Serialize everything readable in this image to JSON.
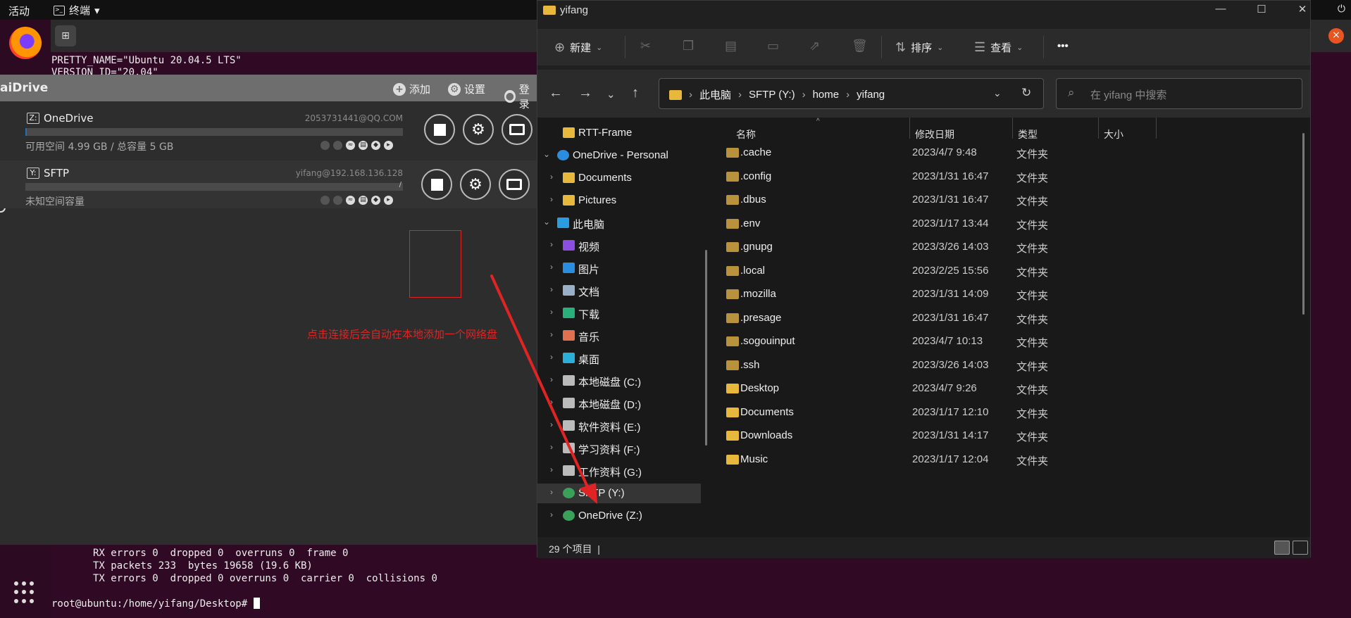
{
  "topbar": {
    "activities": "活动",
    "app_menu": "终端",
    "menu_caret": "▾",
    "power": "⏻"
  },
  "terminal": {
    "new_tab_glyph": "⊞",
    "close_glyph": "×",
    "lines_top": [
      "PRETTY_NAME=\"Ubuntu 20.04.5 LTS\"",
      "VERSION_ID=\"20.04\""
    ],
    "lines_bottom": [
      "       RX errors 0  dropped 0  overruns 0  frame 0",
      "       TX packets 233  bytes 19658 (19.6 KB)",
      "       TX errors 0  dropped 0 overruns 0  carrier 0  collisions 0"
    ],
    "prompt": "root@ubuntu:/home/yifang/Desktop# "
  },
  "raidrive": {
    "title": "aiDrive",
    "toolbar": {
      "add": "添加",
      "settings": "设置",
      "login": "登录"
    },
    "drives": [
      {
        "letter": "Z:",
        "name": "OneDrive",
        "account": "2053731441@QQ.COM",
        "space": "可用空间 4.99 GB / 总容量 5 GB",
        "usage": 0.004
      },
      {
        "letter": "Y:",
        "name": "SFTP",
        "account": "yifang@192.168.136.128",
        "space": "未知空间容量",
        "usage": 0,
        "path_label": "/"
      }
    ],
    "annotation": "点击连接后会自动在本地添加一个网络盘",
    "colors": {
      "annotation": "#e02424",
      "usage_bar": "#2b6cb0"
    }
  },
  "explorer": {
    "title": "yifang",
    "window_controls": [
      "—",
      "☐",
      "✕"
    ],
    "cmdbar": {
      "new": "新建",
      "sort": "排序",
      "view": "查看",
      "more": "•••"
    },
    "breadcrumb": [
      "此电脑",
      "SFTP (Y:)",
      "home",
      "yifang"
    ],
    "search_placeholder": "在 yifang 中搜索",
    "nav": [
      {
        "label": "RTT-Frame",
        "icon": "folder-icon",
        "chev": "",
        "level": 1,
        "color": "#e8b83c"
      },
      {
        "label": "OneDrive - Personal",
        "icon": "cloud-icon",
        "chev": "⌄",
        "level": 0,
        "color": "#2a8de0"
      },
      {
        "label": "Documents",
        "icon": "folder-icon",
        "chev": "›",
        "level": 1,
        "color": "#e8b83c"
      },
      {
        "label": "Pictures",
        "icon": "folder-icon",
        "chev": "›",
        "level": 1,
        "color": "#e8b83c"
      },
      {
        "label": "此电脑",
        "icon": "monitor-icon",
        "chev": "⌄",
        "level": 0,
        "color": "#2a9de0"
      },
      {
        "label": "视频",
        "icon": "video-icon",
        "chev": "›",
        "level": 1,
        "color": "#8a4ee0"
      },
      {
        "label": "图片",
        "icon": "picture-icon",
        "chev": "›",
        "level": 1,
        "color": "#2a8de0"
      },
      {
        "label": "文档",
        "icon": "document-icon",
        "chev": "›",
        "level": 1,
        "color": "#9ab0c8"
      },
      {
        "label": "下载",
        "icon": "download-icon",
        "chev": "›",
        "level": 1,
        "color": "#2ab07a"
      },
      {
        "label": "音乐",
        "icon": "music-icon",
        "chev": "›",
        "level": 1,
        "color": "#e0704e"
      },
      {
        "label": "桌面",
        "icon": "desktop-icon",
        "chev": "›",
        "level": 1,
        "color": "#2ab0d8"
      },
      {
        "label": "本地磁盘 (C:)",
        "icon": "drive-icon",
        "chev": "›",
        "level": 1,
        "color": "#bbbbbb"
      },
      {
        "label": "本地磁盘 (D:)",
        "icon": "drive-icon",
        "chev": "›",
        "level": 1,
        "color": "#bbbbbb"
      },
      {
        "label": "软件资料 (E:)",
        "icon": "drive-icon",
        "chev": "›",
        "level": 1,
        "color": "#bbbbbb"
      },
      {
        "label": "学习资料 (F:)",
        "icon": "drive-icon",
        "chev": "›",
        "level": 1,
        "color": "#bbbbbb"
      },
      {
        "label": "工作资料 (G:)",
        "icon": "drive-icon",
        "chev": "›",
        "level": 1,
        "color": "#bbbbbb"
      },
      {
        "label": "SFTP (Y:)",
        "icon": "network-drive-icon",
        "chev": "›",
        "level": 1,
        "color": "#3aa05a"
      },
      {
        "label": "OneDrive (Z:)",
        "icon": "network-drive-icon",
        "chev": "›",
        "level": 1,
        "color": "#3aa05a"
      }
    ],
    "columns": [
      "名称",
      "修改日期",
      "类型",
      "大小"
    ],
    "files": [
      {
        "name": ".cache",
        "date": "2023/4/7 9:48",
        "type": "文件夹"
      },
      {
        "name": ".config",
        "date": "2023/1/31 16:47",
        "type": "文件夹"
      },
      {
        "name": ".dbus",
        "date": "2023/1/31 16:47",
        "type": "文件夹"
      },
      {
        "name": ".env",
        "date": "2023/1/17 13:44",
        "type": "文件夹"
      },
      {
        "name": ".gnupg",
        "date": "2023/3/26 14:03",
        "type": "文件夹"
      },
      {
        "name": ".local",
        "date": "2023/2/25 15:56",
        "type": "文件夹"
      },
      {
        "name": ".mozilla",
        "date": "2023/1/31 14:09",
        "type": "文件夹"
      },
      {
        "name": ".presage",
        "date": "2023/1/31 16:47",
        "type": "文件夹"
      },
      {
        "name": ".sogouinput",
        "date": "2023/4/7 10:13",
        "type": "文件夹"
      },
      {
        "name": ".ssh",
        "date": "2023/3/26 14:03",
        "type": "文件夹"
      },
      {
        "name": "Desktop",
        "date": "2023/4/7 9:26",
        "type": "文件夹"
      },
      {
        "name": "Documents",
        "date": "2023/1/17 12:10",
        "type": "文件夹"
      },
      {
        "name": "Downloads",
        "date": "2023/1/31 14:17",
        "type": "文件夹"
      },
      {
        "name": "Music",
        "date": "2023/1/17 12:04",
        "type": "文件夹"
      }
    ],
    "status_count": "29 个项目",
    "status_sep": "|"
  }
}
